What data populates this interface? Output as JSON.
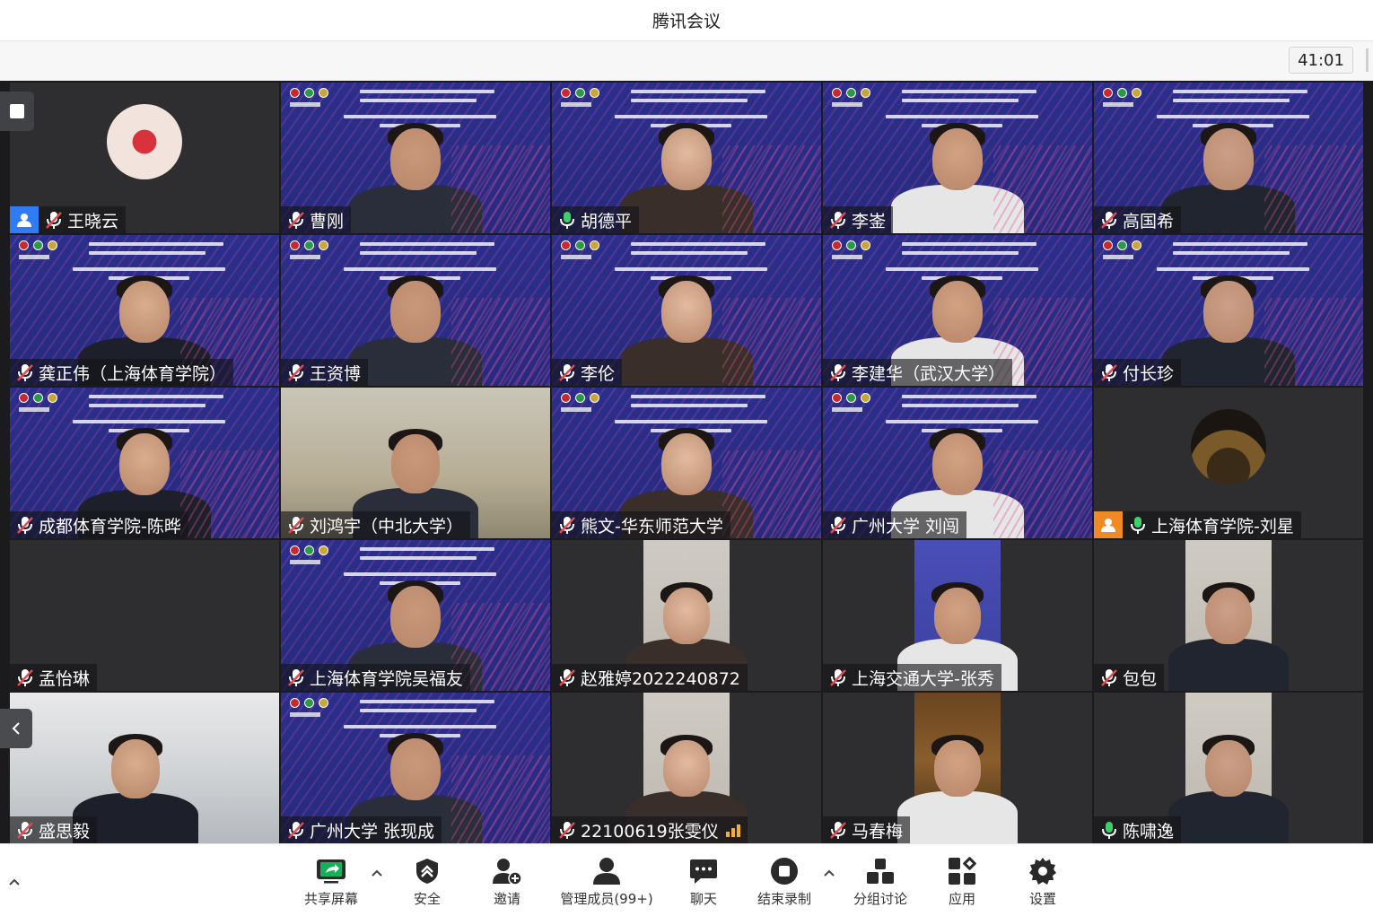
{
  "window": {
    "title": "腾讯会议"
  },
  "infobar": {
    "timer": "41:01"
  },
  "participants": [
    {
      "name": "王晓云",
      "mic": "muted",
      "host": true,
      "scene": "avatar"
    },
    {
      "name": "曹刚",
      "mic": "muted",
      "scene": "slide"
    },
    {
      "name": "胡德平",
      "mic": "on",
      "scene": "slide"
    },
    {
      "name": "李崟",
      "mic": "muted",
      "scene": "slide"
    },
    {
      "name": "高国希",
      "mic": "muted",
      "scene": "slide"
    },
    {
      "name": "龚正伟（上海体育学院）",
      "mic": "muted",
      "scene": "slide"
    },
    {
      "name": "王资博",
      "mic": "muted",
      "scene": "slide"
    },
    {
      "name": "李伦",
      "mic": "muted",
      "scene": "slide"
    },
    {
      "name": "李建华（武汉大学）",
      "mic": "muted",
      "scene": "slide"
    },
    {
      "name": "付长珍",
      "mic": "muted",
      "scene": "slide"
    },
    {
      "name": "成都体育学院-陈晔",
      "mic": "muted",
      "scene": "slide"
    },
    {
      "name": "刘鸿宇（中北大学）",
      "mic": "muted",
      "scene": "room"
    },
    {
      "name": "熊文-华东师范大学",
      "mic": "muted",
      "scene": "slide"
    },
    {
      "name": "广州大学 刘闯",
      "mic": "muted",
      "scene": "slide"
    },
    {
      "name": "上海体育学院-刘星",
      "mic": "on",
      "host": true,
      "active": true,
      "scene": "avatar-night"
    },
    {
      "name": "孟怡琳",
      "mic": "muted",
      "scene": "empty"
    },
    {
      "name": "上海体育学院吴福友",
      "mic": "muted",
      "scene": "slide"
    },
    {
      "name": "赵雅婷2022240872",
      "mic": "muted",
      "scene": "portrait"
    },
    {
      "name": "上海交通大学-张秀",
      "mic": "muted",
      "scene": "portrait-slide"
    },
    {
      "name": "包包",
      "mic": "muted",
      "scene": "portrait"
    },
    {
      "name": "盛思毅",
      "mic": "muted",
      "scene": "office"
    },
    {
      "name": "广州大学 张现成",
      "mic": "muted",
      "scene": "slide"
    },
    {
      "name": "22100619张雯仪",
      "mic": "muted",
      "scene": "portrait",
      "signal": true
    },
    {
      "name": "马春梅",
      "mic": "muted",
      "scene": "portrait-shelf"
    },
    {
      "name": "陈啸逸",
      "mic": "on",
      "scene": "portrait"
    }
  ],
  "toolbar": {
    "share": "共享屏幕",
    "security": "安全",
    "invite": "邀请",
    "members": "管理成员(99+)",
    "chat": "聊天",
    "record": "结束录制",
    "breakout": "分组讨论",
    "apps": "应用",
    "settings": "设置"
  },
  "colors": {
    "active_border": "#2fbd5f",
    "host_badge": "#2f7cf6",
    "host_badge_alt": "#f08a24",
    "slide_bg": "#2b2f8c"
  }
}
